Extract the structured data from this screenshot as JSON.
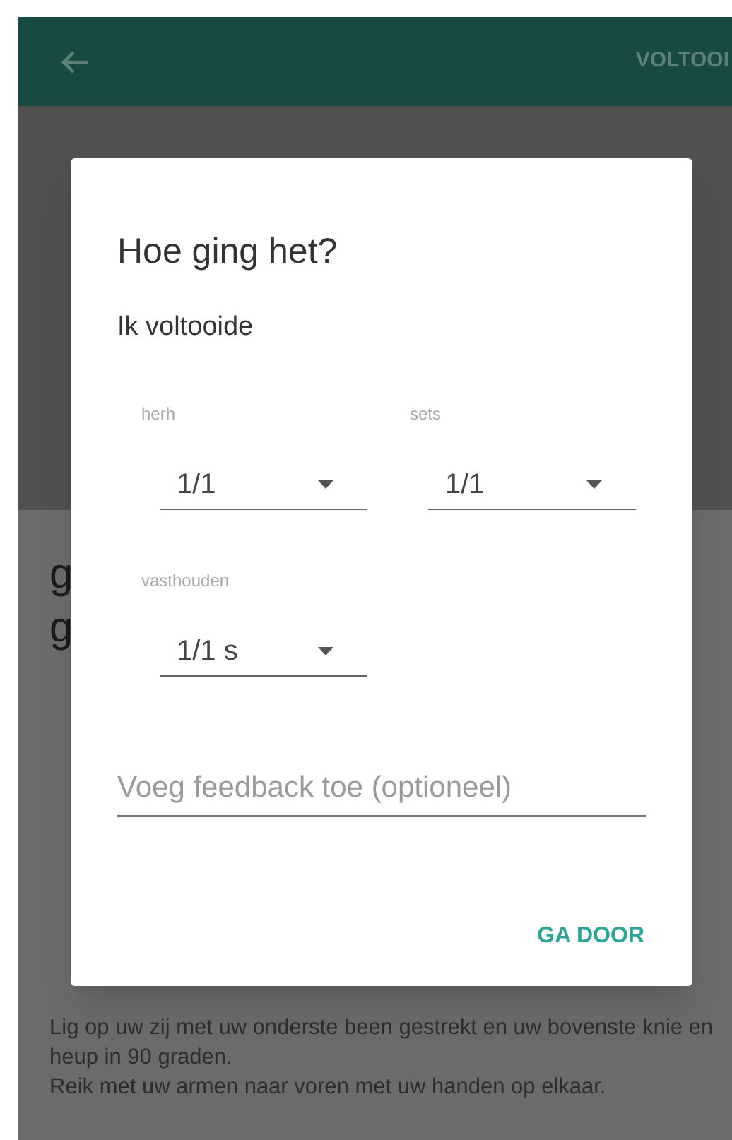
{
  "app_bar": {
    "action": "VOLTOOI"
  },
  "background": {
    "heading_lines": [
      "g",
      "g"
    ],
    "description": [
      "Lig op uw zij met uw onderste been gestrekt en uw bovenste knie en heup in 90 graden.",
      "Reik met uw armen naar voren met uw handen op elkaar."
    ]
  },
  "dialog": {
    "title": "Hoe ging het?",
    "subtitle": "Ik voltooide",
    "selects": [
      {
        "label": "herh",
        "value": "1/1"
      },
      {
        "label": "sets",
        "value": "1/1"
      },
      {
        "label": "vasthouden",
        "value": "1/1 s"
      }
    ],
    "feedback": {
      "placeholder": "Voeg feedback toe (optioneel)"
    },
    "button": "GA DOOR"
  }
}
